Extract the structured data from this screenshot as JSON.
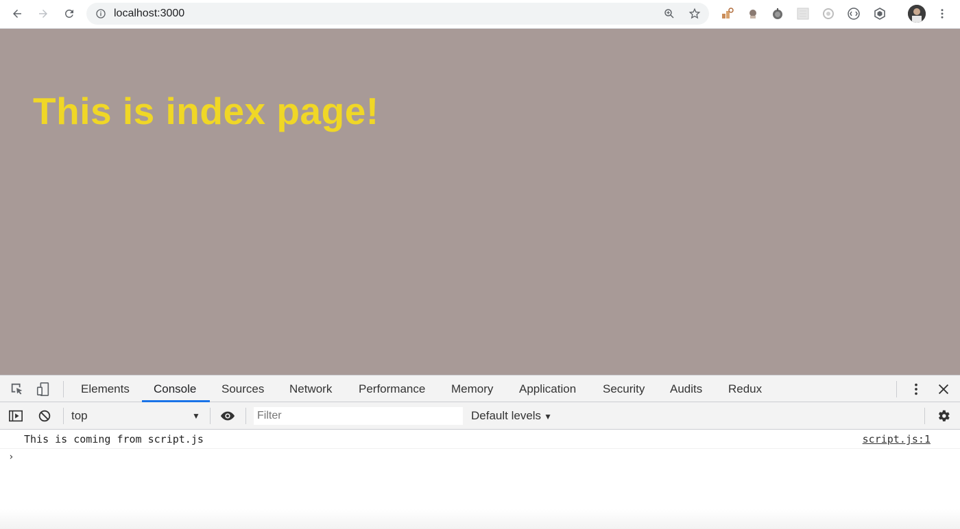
{
  "browser": {
    "url": "localhost:3000",
    "nav": {
      "back_icon": "arrow-left",
      "forward_icon": "arrow-right",
      "reload_icon": "reload"
    },
    "omnibox_icons": [
      "zoom-icon",
      "star-icon"
    ],
    "extensions": [
      "ext-1-icon",
      "ext-2-icon",
      "ext-3-icon",
      "ext-4-icon",
      "ext-5-icon",
      "ext-6-icon",
      "ext-7-icon"
    ],
    "menu_icon": "kebab-menu"
  },
  "page": {
    "heading": "This is index page!",
    "background_color": "#a89a97",
    "heading_color": "#f0d726"
  },
  "devtools": {
    "tabs": [
      {
        "label": "Elements"
      },
      {
        "label": "Console",
        "active": true
      },
      {
        "label": "Sources"
      },
      {
        "label": "Network"
      },
      {
        "label": "Performance"
      },
      {
        "label": "Memory"
      },
      {
        "label": "Application"
      },
      {
        "label": "Security"
      },
      {
        "label": "Audits"
      },
      {
        "label": "Redux"
      }
    ],
    "accent_color": "#1a73e8",
    "console": {
      "context": "top",
      "filter_placeholder": "Filter",
      "levels": "Default levels",
      "messages": [
        {
          "text": "This is coming from script.js",
          "source": "script.js:1"
        }
      ],
      "prompt": "›"
    }
  }
}
